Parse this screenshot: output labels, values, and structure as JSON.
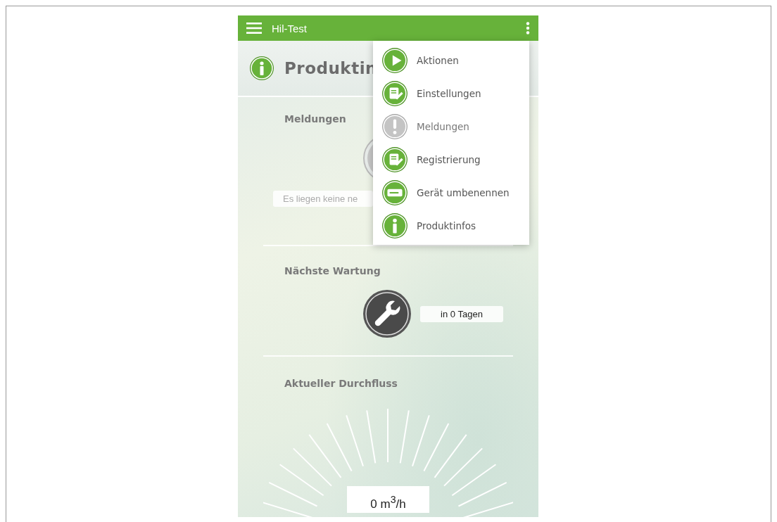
{
  "app_bar": {
    "title": "Hil-Test"
  },
  "page_header": {
    "title": "Produktin"
  },
  "sections": [
    {
      "kind": "messages",
      "title": "Meldungen",
      "message": "Es liegen keine ne"
    },
    {
      "kind": "maintenance",
      "title": "Nächste Wartung",
      "value": "in 0 Tagen"
    },
    {
      "kind": "flow",
      "title": "Aktueller Durchfluss",
      "value": "0 m$^{3}$/h"
    }
  ],
  "menu": {
    "items": [
      {
        "label": "Aktionen",
        "kind": "play",
        "disabled": false
      },
      {
        "label": "Einstellungen",
        "kind": "form",
        "disabled": false
      },
      {
        "label": "Meldungen",
        "kind": "alert",
        "disabled": true
      },
      {
        "label": "Registrierung",
        "kind": "form",
        "disabled": false
      },
      {
        "label": "Gerät umbenennen",
        "kind": "rename",
        "disabled": false
      },
      {
        "label": "Produktinfos",
        "kind": "info",
        "disabled": false
      }
    ]
  }
}
